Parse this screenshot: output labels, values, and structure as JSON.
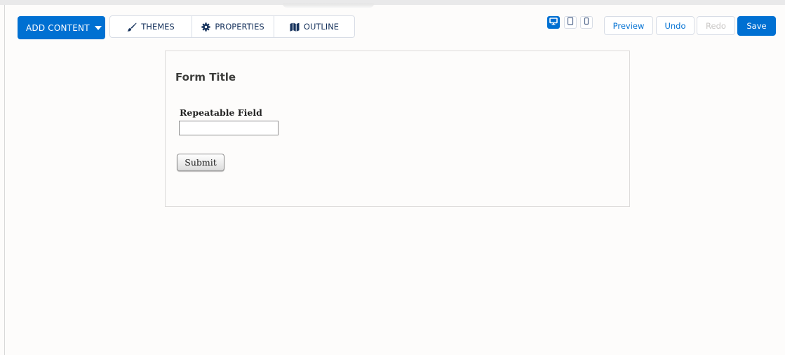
{
  "toolbar": {
    "add_content": "ADD CONTENT",
    "tabs": {
      "themes": "THEMES",
      "properties": "PROPERTIES",
      "outline": "OUTLINE"
    },
    "devices": {
      "active": "desktop",
      "options": [
        "desktop",
        "tablet",
        "phone"
      ]
    },
    "preview": "Preview",
    "undo": "Undo",
    "redo": "Redo",
    "save": "Save"
  },
  "form": {
    "title": "Form Title",
    "field_label": "Repeatable Field",
    "field_value": "",
    "submit": "Submit"
  },
  "icons": {
    "add_content": "caret-down-icon",
    "themes": "paintbrush-icon",
    "properties": "gear-icon",
    "outline": "map-icon",
    "desktop": "desktop-icon",
    "tablet": "tablet-icon",
    "phone": "phone-icon"
  },
  "colors": {
    "brand": "#0070d2",
    "border": "#d8dde6",
    "text": "#16325c",
    "disabled": "#c9c7c5"
  }
}
